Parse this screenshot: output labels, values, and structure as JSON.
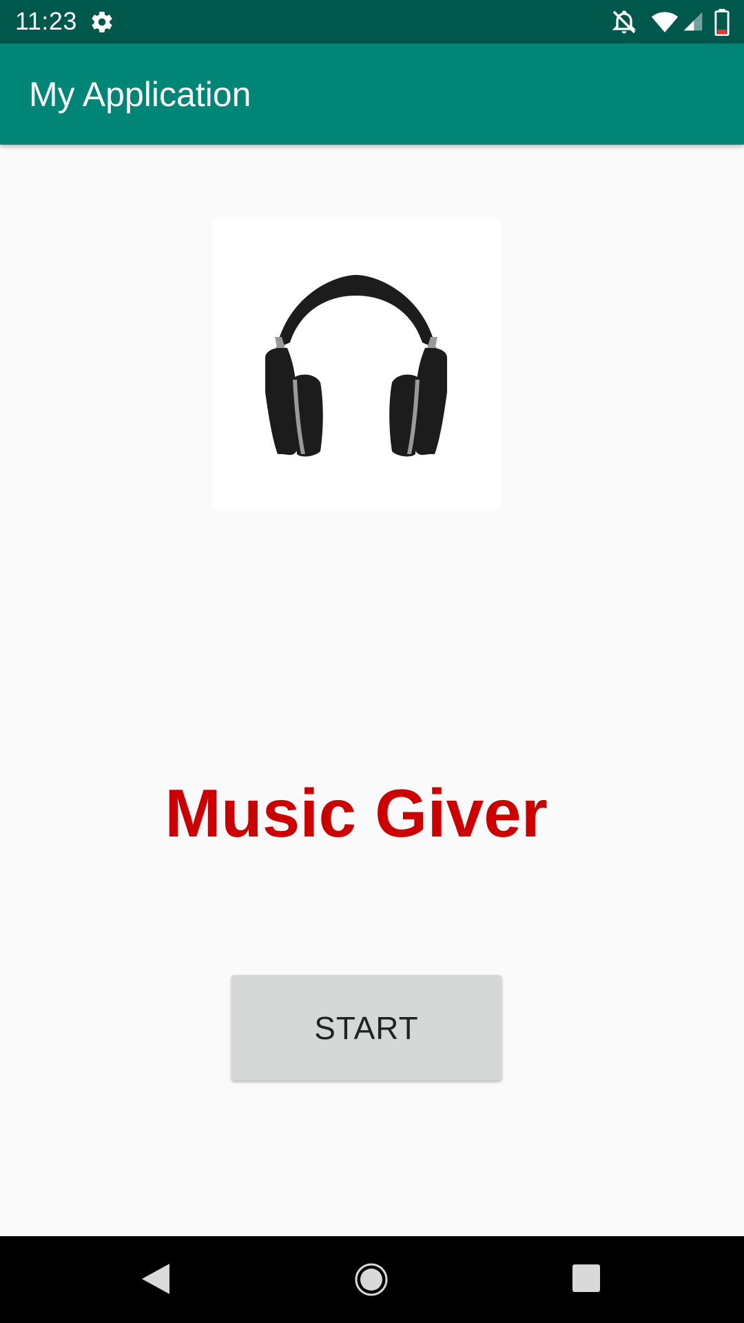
{
  "status_bar": {
    "time": "11:23",
    "icons": [
      "settings-icon",
      "notifications-off-icon",
      "wifi-icon",
      "cellular-signal-icon",
      "battery-icon"
    ]
  },
  "app_bar": {
    "title": "My Application"
  },
  "main": {
    "image_icon": "headphones-icon",
    "title": "Music Giver",
    "start_label": "START"
  },
  "nav_bar": {
    "icons": [
      "back-icon",
      "home-icon",
      "recents-icon"
    ]
  },
  "colors": {
    "status_bar": "#00574b",
    "app_bar": "#008577",
    "title_text": "#cc0000",
    "button_bg": "#d6d7d7",
    "background": "#fafafa"
  }
}
